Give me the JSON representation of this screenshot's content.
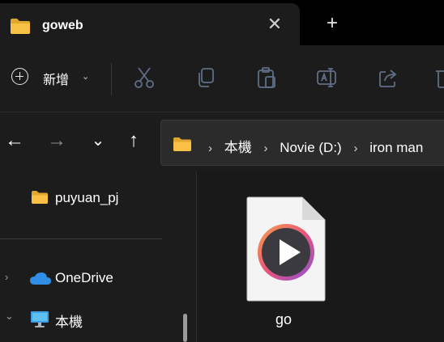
{
  "window": {
    "tab_title": "goweb",
    "tab_close_glyph": "✕",
    "new_tab_glyph": "+"
  },
  "toolbar": {
    "new_label": "新增",
    "new_chevron": "⌄",
    "icons": [
      "cut-icon",
      "copy-icon",
      "paste-icon",
      "rename-icon",
      "share-icon",
      "delete-icon"
    ]
  },
  "nav": {
    "back_glyph": "←",
    "forward_glyph": "→",
    "recent_glyph": "⌄",
    "up_glyph": "↑"
  },
  "address": {
    "crumbs": [
      "本機",
      "Novie (D:)",
      "iron man"
    ],
    "separator": "›"
  },
  "sidebar": {
    "items": [
      {
        "label": "puyuan_pj",
        "icon": "folder-icon"
      },
      {
        "label": "OneDrive",
        "icon": "onedrive-cloud-icon",
        "chevron": "›"
      },
      {
        "label": "本機",
        "icon": "this-pc-monitor-icon",
        "chevron": "⌄"
      }
    ]
  },
  "content": {
    "files": [
      {
        "name": "go",
        "icon": "media-play-file-icon"
      }
    ]
  },
  "colors": {
    "background": "#191919",
    "chrome": "#1c1c1c",
    "titlebar": "#000000",
    "folder_yellow": "#f8c146",
    "onedrive_blue": "#2f8ee5"
  }
}
